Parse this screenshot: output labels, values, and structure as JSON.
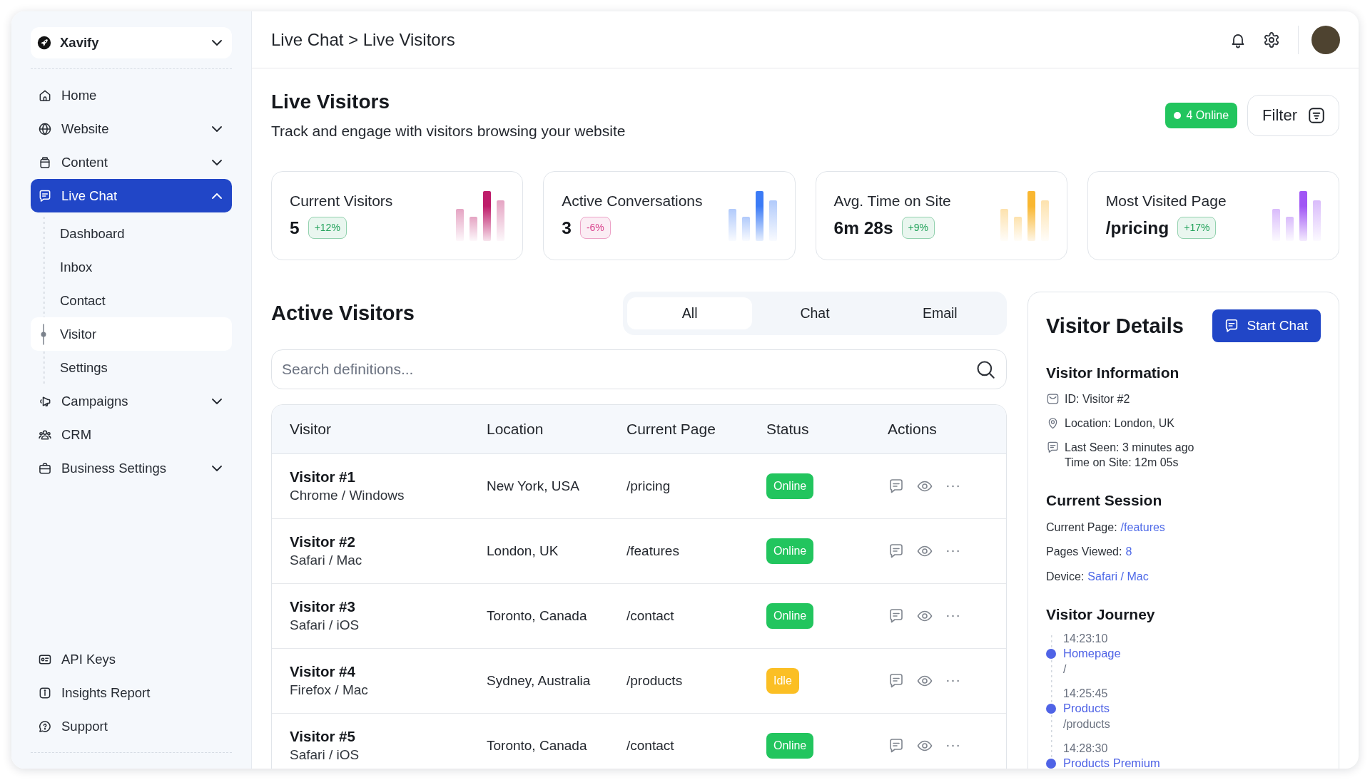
{
  "sidebar": {
    "brand": {
      "name": "Xavify"
    },
    "nav": [
      {
        "label": "Home",
        "kind": "link",
        "selected": false
      },
      {
        "label": "Website",
        "kind": "group",
        "expanded": false,
        "selected": false
      },
      {
        "label": "Content",
        "kind": "group",
        "expanded": false,
        "selected": false
      },
      {
        "label": "Live Chat",
        "kind": "group",
        "expanded": true,
        "selected": true,
        "children": [
          {
            "label": "Dashboard",
            "selected": false
          },
          {
            "label": "Inbox",
            "selected": false
          },
          {
            "label": "Contact",
            "selected": false
          },
          {
            "label": "Visitor",
            "selected": true
          },
          {
            "label": "Settings",
            "selected": false
          }
        ]
      },
      {
        "label": "Campaigns",
        "kind": "group",
        "expanded": false,
        "selected": false
      },
      {
        "label": "CRM",
        "kind": "link",
        "selected": false
      },
      {
        "label": "Business Settings",
        "kind": "group",
        "expanded": false,
        "selected": false
      }
    ],
    "footer_nav": [
      {
        "label": "API Keys",
        "selected": false
      },
      {
        "label": "Insights Report",
        "selected": false
      },
      {
        "label": "Support",
        "selected": false
      }
    ]
  },
  "header": {
    "breadcrumb": "Live Chat > Live Visitors"
  },
  "page": {
    "title": "Live Visitors",
    "subtitle": "Track and engage with visitors browsing your website",
    "online_badge": "4 Online",
    "filter_button": "Filter"
  },
  "stats": [
    {
      "label": "Current Visitors",
      "value": "5",
      "change": {
        "label": "+12%",
        "color": "#24a35c"
      },
      "color": "#be1c6a"
    },
    {
      "label": "Active Conversations",
      "value": "3",
      "change": {
        "label": "-6%",
        "color": "#d9468f"
      },
      "color": "#3b7bf6"
    },
    {
      "label": "Avg. Time on Site",
      "value": "6m 28s",
      "change": {
        "label": "+9%",
        "color": "#24a35c"
      },
      "color": "#f9b731"
    },
    {
      "label": "Most Visited Page",
      "value": "/pricing",
      "change": {
        "label": "+17%",
        "color": "#24a35c"
      },
      "color": "#a055f5"
    }
  ],
  "active_visitors": {
    "title": "Active Visitors",
    "tabs": [
      {
        "label": "All",
        "selected": true
      },
      {
        "label": "Chat",
        "selected": false
      },
      {
        "label": "Email",
        "selected": false
      }
    ],
    "search": {
      "placeholder": "Search definitions..."
    },
    "table": {
      "columns": [
        "Visitor",
        "Location",
        "Current Page",
        "Status",
        "Actions"
      ],
      "rows": [
        {
          "visitor": "Visitor #1",
          "browser": "Chrome / Windows",
          "location": "New York, USA",
          "page": "/pricing",
          "status": {
            "label": "Online",
            "color": "#22c55e"
          }
        },
        {
          "visitor": "Visitor #2",
          "browser": "Safari / Mac",
          "location": "London, UK",
          "page": "/features",
          "status": {
            "label": "Online",
            "color": "#22c55e"
          }
        },
        {
          "visitor": "Visitor #3",
          "browser": "Safari / iOS",
          "location": "Toronto, Canada",
          "page": "/contact",
          "status": {
            "label": "Online",
            "color": "#22c55e"
          }
        },
        {
          "visitor": "Visitor #4",
          "browser": "Firefox / Mac",
          "location": "Sydney, Australia",
          "page": "/products",
          "status": {
            "label": "Idle",
            "color": "#fbbf24"
          }
        },
        {
          "visitor": "Visitor #5",
          "browser": "Safari / iOS",
          "location": "Toronto, Canada",
          "page": "/contact",
          "status": {
            "label": "Online",
            "color": "#22c55e"
          }
        }
      ]
    }
  },
  "visitor_details": {
    "title": "Visitor Details",
    "start_chat_button": "Start Chat",
    "info": {
      "title": "Visitor Information",
      "items": [
        {
          "lines": [
            "ID: Visitor #2"
          ]
        },
        {
          "lines": [
            "Location: London, UK"
          ]
        },
        {
          "lines": [
            "Last Seen: 3 minutes ago",
            "Time on Site: 12m 05s"
          ]
        }
      ]
    },
    "session": {
      "title": "Current Session",
      "items": [
        {
          "label": "Current Page:",
          "value": "/features"
        },
        {
          "label": "Pages Viewed:",
          "value": "8"
        },
        {
          "label": "Device:",
          "value": "Safari / Mac"
        }
      ]
    },
    "journey": {
      "title": "Visitor Journey",
      "steps": [
        {
          "time": "14:23:10",
          "page": "Homepage",
          "path": "/"
        },
        {
          "time": "14:25:45",
          "page": "Products",
          "path": "/products"
        },
        {
          "time": "14:28:30",
          "page": "Products Premium"
        }
      ]
    }
  }
}
